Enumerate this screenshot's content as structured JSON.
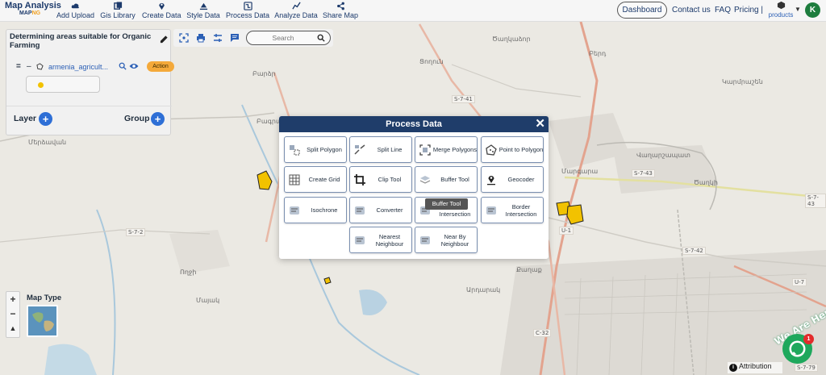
{
  "app": {
    "logo_line1": "Map Analysis",
    "logo_line2a": "MAP",
    "logo_line2b": "NG"
  },
  "nav": {
    "items": [
      {
        "label": "Add Upload",
        "icon": "cloud-upload-icon"
      },
      {
        "label": "Gis Library",
        "icon": "library-icon"
      },
      {
        "label": "Create Data",
        "icon": "map-pin-icon"
      },
      {
        "label": "Style Data",
        "icon": "style-icon"
      },
      {
        "label": "Process Data",
        "icon": "process-icon"
      },
      {
        "label": "Analyze Data",
        "icon": "analyze-icon"
      },
      {
        "label": "Share Map",
        "icon": "share-icon"
      }
    ],
    "dashboard": "Dashboard",
    "contact": "Contact us",
    "faq": "FAQ",
    "pricing": "Pricing |",
    "products": "products",
    "avatar_initial": "K"
  },
  "panel": {
    "project_title": "Determining areas suitable for Organic Farming",
    "layer_name": "armenia_agricult...",
    "action_label": "Action",
    "layer_label": "Layer",
    "group_label": "Group"
  },
  "toolbar": {
    "search_placeholder": "Search"
  },
  "dialog": {
    "title": "Process Data",
    "close": "✕",
    "tools": [
      {
        "label": "Split Polygon",
        "icon": "split-polygon-icon"
      },
      {
        "label": "Split Line",
        "icon": "split-line-icon"
      },
      {
        "label": "Merge Polygons",
        "icon": "merge-polygons-icon"
      },
      {
        "label": "Point to Polygon",
        "icon": "point-to-polygon-icon"
      },
      {
        "label": "Create Grid",
        "icon": "grid-icon"
      },
      {
        "label": "Clip Tool",
        "icon": "crop-icon"
      },
      {
        "label": "Buffer Tool",
        "icon": "buffer-icon"
      },
      {
        "label": "Geocoder",
        "icon": "geocoder-pin-icon"
      },
      {
        "label": "Isochrone",
        "icon": "isochrone-icon"
      },
      {
        "label": "Converter",
        "icon": "converter-icon"
      },
      {
        "label": "Intersection",
        "icon": "intersection-icon"
      },
      {
        "label": "Border Intersection",
        "icon": "border-intersection-icon"
      },
      {
        "label": "Nearest Neighbour",
        "icon": "nearest-neighbour-icon"
      },
      {
        "label": "Near By Neighbour",
        "icon": "nearby-neighbour-icon"
      }
    ],
    "tooltip": "Buffer Tool"
  },
  "map": {
    "zoom_in": "+",
    "zoom_out": "−",
    "map_type_label": "Map Type",
    "attribution": "Attribution",
    "chat_banner": "We Are Here!",
    "chat_badge": "1",
    "place_labels": [
      "Ծաղկաձոր",
      "Ցողուն",
      "Բերդ",
      "Կարմրաշեն",
      "Վաղարշապատ",
      "Մերձավան",
      "Մարգարա",
      "Ծաղկի",
      "Բարձր",
      "Բագրատ",
      "Ողջի",
      "Մայակ",
      "Արդարակ",
      "Քաղաք"
    ],
    "road_labels": [
      "S-7-41",
      "S-7-43",
      "S-7-43",
      "S-7-2",
      "S-7-42",
      "U-1",
      "U-7",
      "C-32",
      "S-7-79"
    ],
    "colors": {
      "road_major": "#e3a38e",
      "water": "#a9c8dc",
      "urban": "#d6d3cd",
      "highlight": "#f2c200"
    }
  }
}
